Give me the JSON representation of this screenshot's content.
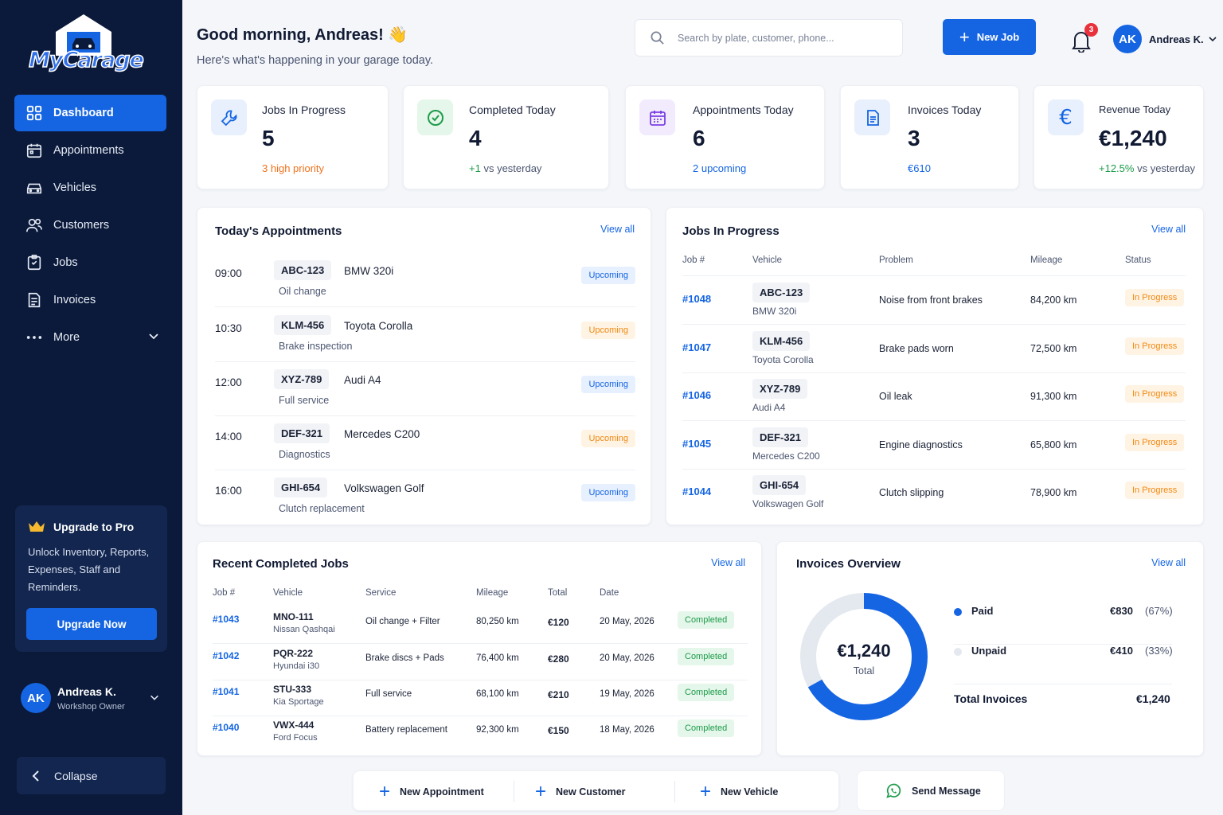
{
  "brand": {
    "name": "MyCarage"
  },
  "sidebar": {
    "items": [
      {
        "label": "Dashboard",
        "icon": "grid-icon"
      },
      {
        "label": "Appointments",
        "icon": "calendar-icon"
      },
      {
        "label": "Vehicles",
        "icon": "car-icon"
      },
      {
        "label": "Customers",
        "icon": "users-icon"
      },
      {
        "label": "Jobs",
        "icon": "clipboard-icon"
      },
      {
        "label": "Invoices",
        "icon": "invoice-icon"
      },
      {
        "label": "More",
        "icon": "dots-icon"
      }
    ],
    "upgrade": {
      "title": "Upgrade to Pro",
      "text": "Unlock Inventory, Reports, Expenses, Staff and Reminders.",
      "button": "Upgrade Now"
    },
    "user": {
      "initials": "AK",
      "name": "Andreas K.",
      "role": "Workshop Owner"
    },
    "collapse": "Collapse"
  },
  "header": {
    "greeting": "Good morning, Andreas! 👋",
    "subtitle": "Here's what's happening in your garage today.",
    "search_placeholder": "Search by plate, customer, phone...",
    "new_job": "New Job",
    "notifications": "3",
    "user_initials": "AK",
    "user_name": "Andreas K."
  },
  "stats": [
    {
      "label": "Jobs In Progress",
      "value": "5",
      "sub": "3 high priority",
      "icon": "wrench-icon"
    },
    {
      "label": "Completed Today",
      "value": "4",
      "sub_strong": "+1",
      "sub": "vs yesterday",
      "icon": "check-circle-icon"
    },
    {
      "label": "Appointments Today",
      "value": "6",
      "sub": "2 upcoming",
      "icon": "calendar-icon"
    },
    {
      "label": "Invoices Today",
      "value": "3",
      "sub": "€610",
      "icon": "document-icon"
    },
    {
      "label": "Revenue Today",
      "value": "€1,240",
      "sub_strong": "+12.5%",
      "sub": "vs yesterday",
      "icon": "euro-icon"
    }
  ],
  "appointments": {
    "title": "Today's Appointments",
    "view_all": "View all",
    "items": [
      {
        "time": "09:00",
        "plate": "ABC-123",
        "car": "BMW 320i",
        "service": "Oil change",
        "status": "Upcoming"
      },
      {
        "time": "10:30",
        "plate": "KLM-456",
        "car": "Toyota Corolla",
        "service": "Brake inspection",
        "status": "Upcoming"
      },
      {
        "time": "12:00",
        "plate": "XYZ-789",
        "car": "Audi A4",
        "service": "Full service",
        "status": "Upcoming"
      },
      {
        "time": "14:00",
        "plate": "DEF-321",
        "car": "Mercedes C200",
        "service": "Diagnostics",
        "status": "Upcoming"
      },
      {
        "time": "16:00",
        "plate": "GHI-654",
        "car": "Volkswagen Golf",
        "service": "Clutch replacement",
        "status": "Upcoming"
      }
    ]
  },
  "jobs": {
    "title": "Jobs In Progress",
    "view_all": "View all",
    "columns": [
      "Job #",
      "Vehicle",
      "Problem",
      "Mileage",
      "Status"
    ],
    "rows": [
      {
        "id": "#1048",
        "plate": "ABC-123",
        "model": "BMW 320i",
        "problem": "Noise from front brakes",
        "mileage": "84,200 km",
        "status": "In Progress"
      },
      {
        "id": "#1047",
        "plate": "KLM-456",
        "model": "Toyota Corolla",
        "problem": "Brake pads worn",
        "mileage": "72,500 km",
        "status": "In Progress"
      },
      {
        "id": "#1046",
        "plate": "XYZ-789",
        "model": "Audi A4",
        "problem": "Oil leak",
        "mileage": "91,300 km",
        "status": "In Progress"
      },
      {
        "id": "#1045",
        "plate": "DEF-321",
        "model": "Mercedes C200",
        "problem": "Engine diagnostics",
        "mileage": "65,800 km",
        "status": "In Progress"
      },
      {
        "id": "#1044",
        "plate": "GHI-654",
        "model": "Volkswagen Golf",
        "problem": "Clutch slipping",
        "mileage": "78,900 km",
        "status": "In Progress"
      }
    ]
  },
  "completed": {
    "title": "Recent Completed Jobs",
    "view_all": "View all",
    "columns": [
      "Job #",
      "Vehicle",
      "Service",
      "Mileage",
      "Total",
      "Date"
    ],
    "rows": [
      {
        "id": "#1043",
        "plate": "MNO-111",
        "model": "Nissan Qashqai",
        "service": "Oil change + Filter",
        "mileage": "80,250 km",
        "total": "€120",
        "date": "20 May, 2026",
        "status": "Completed"
      },
      {
        "id": "#1042",
        "plate": "PQR-222",
        "model": "Hyundai i30",
        "service": "Brake discs + Pads",
        "mileage": "76,400 km",
        "total": "€280",
        "date": "20 May, 2026",
        "status": "Completed"
      },
      {
        "id": "#1041",
        "plate": "STU-333",
        "model": "Kia Sportage",
        "service": "Full service",
        "mileage": "68,100 km",
        "total": "€210",
        "date": "19 May, 2026",
        "status": "Completed"
      },
      {
        "id": "#1040",
        "plate": "VWX-444",
        "model": "Ford Focus",
        "service": "Battery replacement",
        "mileage": "92,300 km",
        "total": "€150",
        "date": "18 May, 2026",
        "status": "Completed"
      }
    ]
  },
  "invoices": {
    "title": "Invoices Overview",
    "view_all": "View all",
    "total": "€1,240",
    "total_label": "Total",
    "paid": {
      "label": "Paid",
      "amount": "€830",
      "pct": "(67%)",
      "fraction": 0.67,
      "color": "#1565e3"
    },
    "unpaid": {
      "label": "Unpaid",
      "amount": "€410",
      "pct": "(33%)",
      "fraction": 0.33,
      "color": "#e4e8ef"
    },
    "total_invoices_label": "Total Invoices",
    "total_invoices": "€1,240"
  },
  "quick_actions": {
    "new_appointment": "New Appointment",
    "new_customer": "New Customer",
    "new_vehicle": "New Vehicle",
    "send_message": "Send Message"
  }
}
